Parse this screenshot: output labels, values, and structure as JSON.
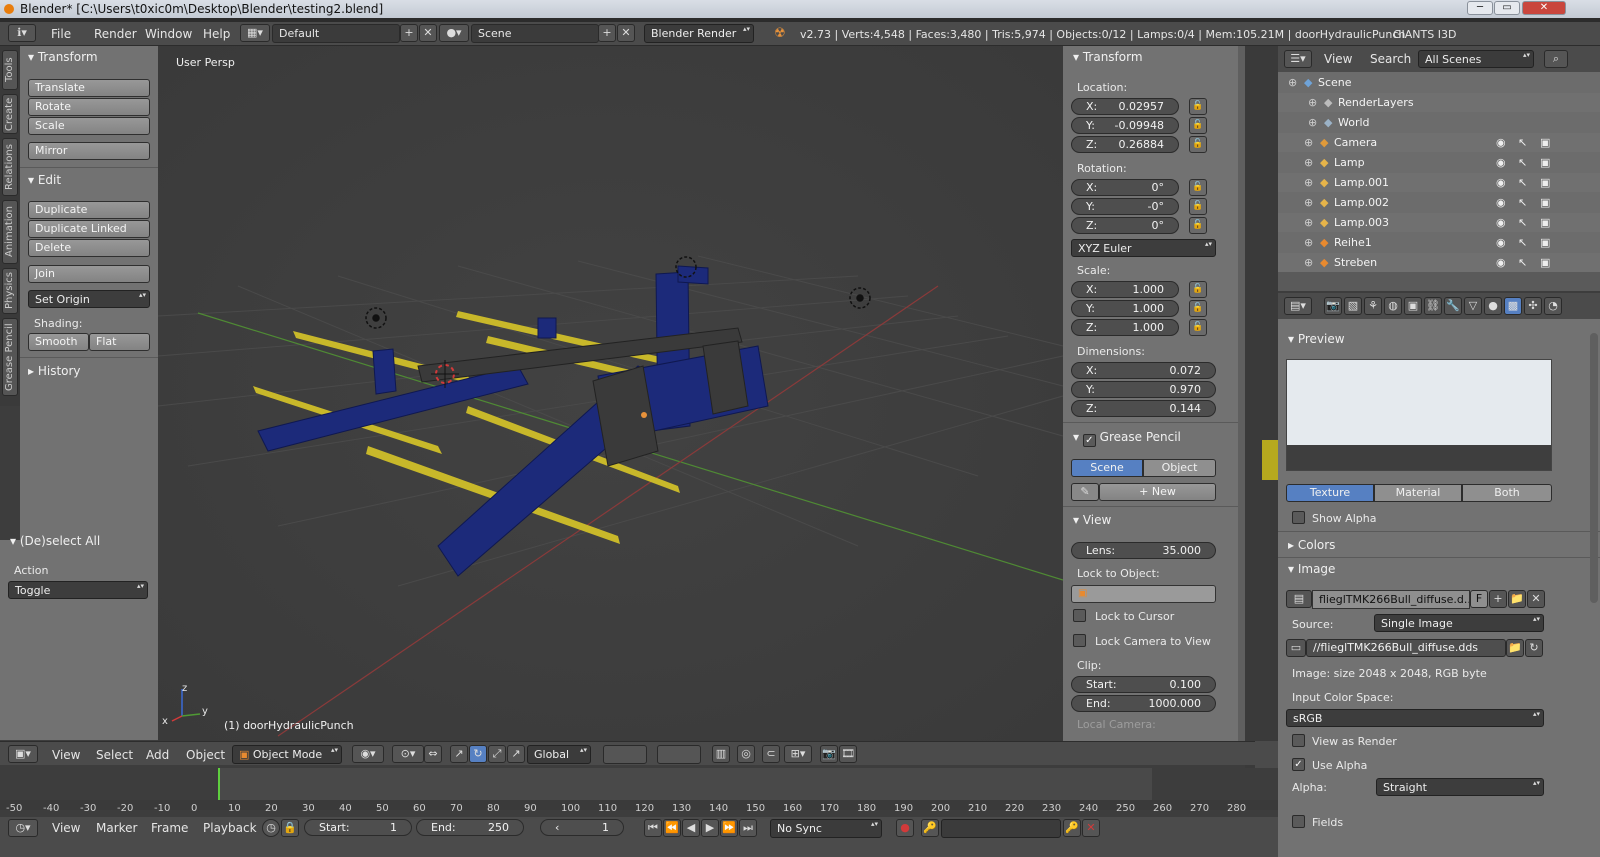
{
  "window": {
    "title": "Blender* [C:\\Users\\t0xic0m\\Desktop\\Blender\\testing2.blend]",
    "controls": [
      "─",
      "▭",
      "✕"
    ]
  },
  "info": {
    "menus": [
      "File",
      "Render",
      "Window",
      "Help"
    ],
    "layout": "Default",
    "scene": "Scene",
    "engine": "Blender Render",
    "stats": "v2.73 | Verts:4,548 | Faces:3,480 | Tris:5,974 | Objects:0/12 | Lamps:0/4 | Mem:105.21M | doorHydraulicPunch",
    "addon": "GIANTS I3D"
  },
  "left_tabs": [
    "Tools",
    "Create",
    "Relations",
    "Animation",
    "Physics",
    "Grease Pencil"
  ],
  "tool_shelf": {
    "transform_title": "Transform",
    "translate": "Translate",
    "rotate": "Rotate",
    "scale": "Scale",
    "mirror": "Mirror",
    "edit_title": "Edit",
    "duplicate": "Duplicate",
    "duplicate_linked": "Duplicate Linked",
    "delete": "Delete",
    "join": "Join",
    "set_origin": "Set Origin",
    "shading_label": "Shading:",
    "smooth": "Smooth",
    "flat": "Flat",
    "history_title": "History"
  },
  "operator": {
    "title": "(De)select All",
    "action_label": "Action",
    "action_value": "Toggle"
  },
  "viewport": {
    "view_name": "User Persp",
    "object_label": "(1) doorHydraulicPunch",
    "axis_x": "x",
    "axis_y": "y",
    "axis_z": "z"
  },
  "npanel": {
    "transform_title": "Transform",
    "location_label": "Location:",
    "loc": [
      {
        "axis": "X:",
        "val": "0.02957"
      },
      {
        "axis": "Y:",
        "val": "-0.09948"
      },
      {
        "axis": "Z:",
        "val": "0.26884"
      }
    ],
    "rotation_label": "Rotation:",
    "rot": [
      {
        "axis": "X:",
        "val": "0°"
      },
      {
        "axis": "Y:",
        "val": "-0°"
      },
      {
        "axis": "Z:",
        "val": "0°"
      }
    ],
    "rotation_mode": "XYZ Euler",
    "scale_label": "Scale:",
    "scl": [
      {
        "axis": "X:",
        "val": "1.000"
      },
      {
        "axis": "Y:",
        "val": "1.000"
      },
      {
        "axis": "Z:",
        "val": "1.000"
      }
    ],
    "dimensions_label": "Dimensions:",
    "dim": [
      {
        "axis": "X:",
        "val": "0.072"
      },
      {
        "axis": "Y:",
        "val": "0.970"
      },
      {
        "axis": "Z:",
        "val": "0.144"
      }
    ],
    "grease_title": "Grease Pencil",
    "gp_scene": "Scene",
    "gp_object": "Object",
    "gp_new": "New",
    "view_title": "View",
    "lens_label": "Lens:",
    "lens_value": "35.000",
    "lock_object_label": "Lock to Object:",
    "lock_cursor": "Lock to Cursor",
    "lock_camera": "Lock Camera to View",
    "clip_label": "Clip:",
    "clip_start_label": "Start:",
    "clip_start": "0.100",
    "clip_end_label": "End:",
    "clip_end": "1000.000",
    "local_camera": "Local Camera:"
  },
  "outliner": {
    "view": "View",
    "search": "Search",
    "filter": "All Scenes",
    "items": [
      {
        "name": "Scene",
        "icon": "scene-icon",
        "color": "#6fa3d8"
      },
      {
        "name": "RenderLayers",
        "icon": "render-layers-icon",
        "color": "#bcbcbc"
      },
      {
        "name": "World",
        "icon": "world-icon",
        "color": "#9bb2c7"
      },
      {
        "name": "Camera",
        "icon": "camera-icon",
        "color": "#e09a3a"
      },
      {
        "name": "Lamp",
        "icon": "lamp-icon",
        "color": "#e6b44a"
      },
      {
        "name": "Lamp.001",
        "icon": "lamp-icon",
        "color": "#e6b44a"
      },
      {
        "name": "Lamp.002",
        "icon": "lamp-icon",
        "color": "#e6b44a"
      },
      {
        "name": "Lamp.003",
        "icon": "lamp-icon",
        "color": "#e6b44a"
      },
      {
        "name": "Reihe1",
        "icon": "mesh-icon",
        "color": "#e88a30"
      },
      {
        "name": "Streben",
        "icon": "mesh-icon",
        "color": "#e88a30"
      }
    ]
  },
  "properties": {
    "preview_title": "Preview",
    "tab_texture": "Texture",
    "tab_material": "Material",
    "tab_both": "Both",
    "show_alpha": "Show Alpha",
    "colors_title": "Colors",
    "image_title": "Image",
    "image_name": "flieglTMK266Bull_diffuse.d...",
    "image_f": "F",
    "source_label": "Source:",
    "source_value": "Single Image",
    "filepath": "//flieglTMK266Bull_diffuse.dds",
    "image_info": "Image: size 2048 x 2048, RGB byte",
    "color_space_label": "Input Color Space:",
    "color_space": "sRGB",
    "view_as_render": "View as Render",
    "use_alpha": "Use Alpha",
    "alpha_label": "Alpha:",
    "alpha_value": "Straight",
    "fields": "Fields"
  },
  "view3d_header": {
    "menus": [
      "View",
      "Select",
      "Add",
      "Object"
    ],
    "mode": "Object Mode",
    "orientation": "Global"
  },
  "timeline": {
    "ticks": [
      "-50",
      "-40",
      "-30",
      "-20",
      "-10",
      "0",
      "10",
      "20",
      "30",
      "40",
      "50",
      "60",
      "70",
      "80",
      "90",
      "100",
      "110",
      "120",
      "130",
      "140",
      "150",
      "160",
      "170",
      "180",
      "190",
      "200",
      "210",
      "220",
      "230",
      "240",
      "250",
      "260",
      "270",
      "280"
    ],
    "menus": [
      "View",
      "Marker",
      "Frame",
      "Playback"
    ],
    "start_label": "Start:",
    "start": "1",
    "end_label": "End:",
    "end": "250",
    "current": "1",
    "sync": "No Sync"
  },
  "colors": {
    "accent_blue": "#5680c2",
    "model_blue": "#1c2a7a",
    "model_yellow": "#c8b82a"
  }
}
